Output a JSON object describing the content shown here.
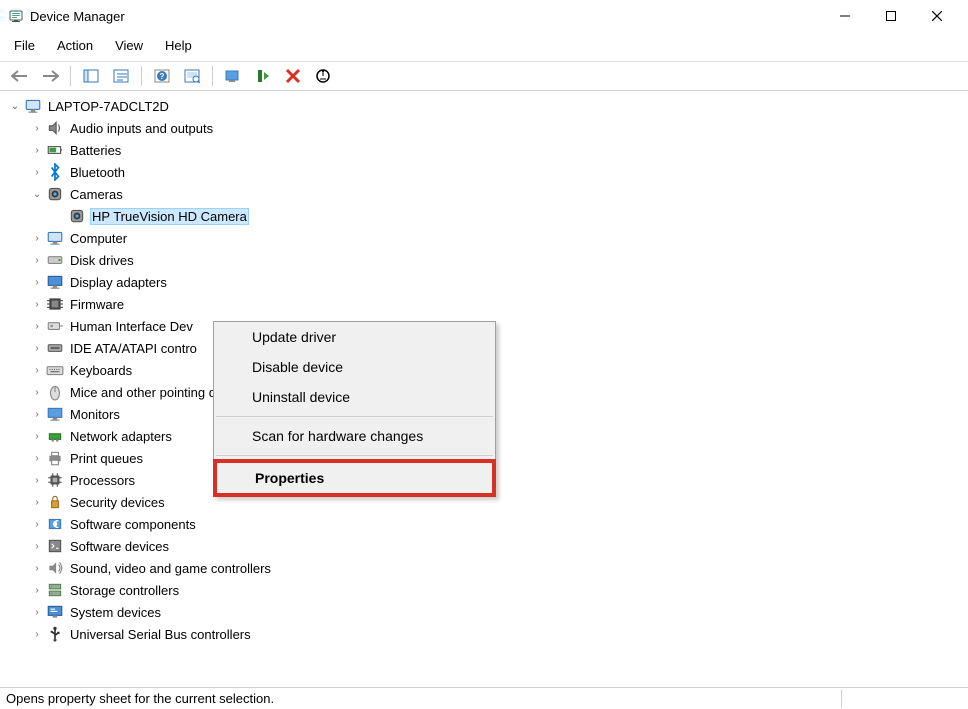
{
  "window": {
    "title": "Device Manager"
  },
  "menubar": {
    "items": [
      "File",
      "Action",
      "View",
      "Help"
    ]
  },
  "tree": {
    "root": "LAPTOP-7ADCLT2D",
    "categories": [
      {
        "label": "Audio inputs and outputs",
        "expanded": false
      },
      {
        "label": "Batteries",
        "expanded": false
      },
      {
        "label": "Bluetooth",
        "expanded": false
      },
      {
        "label": "Cameras",
        "expanded": true,
        "children": [
          {
            "label": "HP TrueVision HD Camera",
            "selected": true
          }
        ]
      },
      {
        "label": "Computer",
        "expanded": false
      },
      {
        "label": "Disk drives",
        "expanded": false
      },
      {
        "label": "Display adapters",
        "expanded": false
      },
      {
        "label": "Firmware",
        "expanded": false
      },
      {
        "label": "Human Interface Dev",
        "expanded": false
      },
      {
        "label": "IDE ATA/ATAPI contro",
        "expanded": false
      },
      {
        "label": "Keyboards",
        "expanded": false
      },
      {
        "label": "Mice and other pointing devices",
        "expanded": false
      },
      {
        "label": "Monitors",
        "expanded": false
      },
      {
        "label": "Network adapters",
        "expanded": false
      },
      {
        "label": "Print queues",
        "expanded": false
      },
      {
        "label": "Processors",
        "expanded": false
      },
      {
        "label": "Security devices",
        "expanded": false
      },
      {
        "label": "Software components",
        "expanded": false
      },
      {
        "label": "Software devices",
        "expanded": false
      },
      {
        "label": "Sound, video and game controllers",
        "expanded": false
      },
      {
        "label": "Storage controllers",
        "expanded": false
      },
      {
        "label": "System devices",
        "expanded": false
      },
      {
        "label": "Universal Serial Bus controllers",
        "expanded": false
      }
    ]
  },
  "context_menu": {
    "items": [
      {
        "label": "Update driver"
      },
      {
        "label": "Disable device"
      },
      {
        "label": "Uninstall device"
      },
      {
        "sep": true
      },
      {
        "label": "Scan for hardware changes"
      },
      {
        "sep": true
      },
      {
        "label": "Properties",
        "highlighted": true
      }
    ]
  },
  "statusbar": {
    "text": "Opens property sheet for the current selection."
  }
}
